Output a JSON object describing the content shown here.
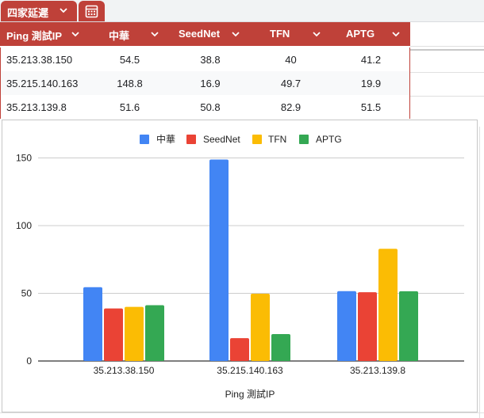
{
  "sheet_tab": {
    "label": "四家延遲"
  },
  "table": {
    "columns": [
      "Ping 測試IP",
      "中華",
      "SeedNet",
      "TFN",
      "APTG"
    ],
    "rows": [
      [
        "35.213.38.150",
        "54.5",
        "38.8",
        "40",
        "41.2"
      ],
      [
        "35.215.140.163",
        "148.8",
        "16.9",
        "49.7",
        "19.9"
      ],
      [
        "35.213.139.8",
        "51.6",
        "50.8",
        "82.9",
        "51.5"
      ]
    ]
  },
  "colors": {
    "header_bg": "#bf4139",
    "zebra_bg": "#f8f9fa"
  },
  "chart_data": {
    "type": "bar",
    "categories": [
      "35.213.38.150",
      "35.215.140.163",
      "35.213.139.8"
    ],
    "series": [
      {
        "name": "中華",
        "color": "#4285f4",
        "values": [
          54.5,
          148.8,
          51.6
        ]
      },
      {
        "name": "SeedNet",
        "color": "#ea4335",
        "values": [
          38.8,
          16.9,
          50.8
        ]
      },
      {
        "name": "TFN",
        "color": "#fbbc04",
        "values": [
          40,
          49.7,
          82.9
        ]
      },
      {
        "name": "APTG",
        "color": "#34a853",
        "values": [
          41.2,
          19.9,
          51.5
        ]
      }
    ],
    "xlabel": "Ping 測試IP",
    "ylabel": "",
    "ylim": [
      0,
      160
    ],
    "yticks": [
      0,
      50,
      100,
      150
    ],
    "grid": true,
    "legend": "top"
  }
}
